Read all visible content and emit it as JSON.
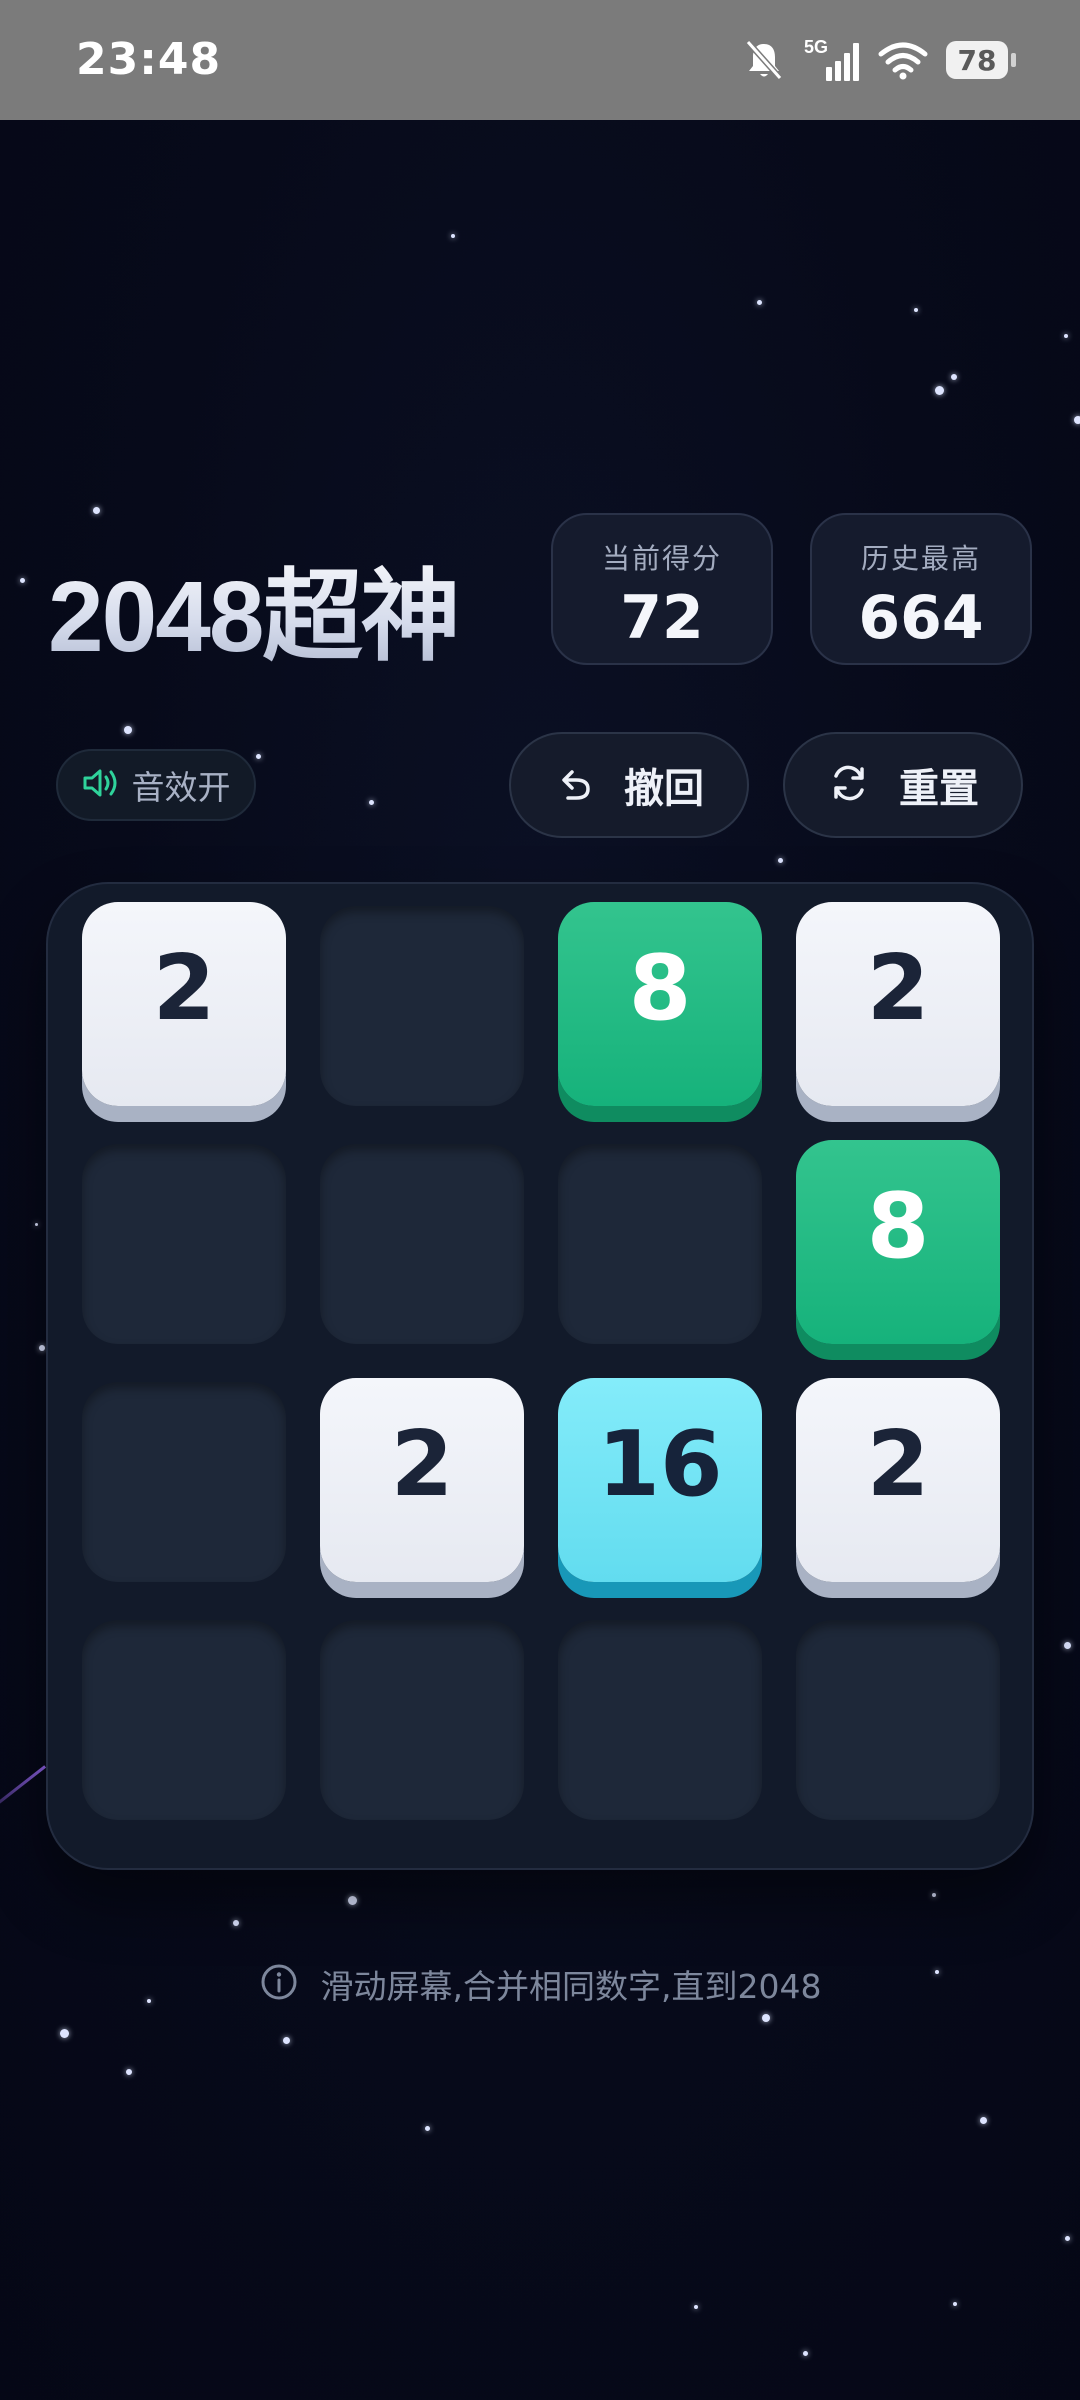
{
  "status_bar": {
    "time": "23:48",
    "network": "5G",
    "battery": "78",
    "icons": [
      "bell-muted-icon",
      "signal-icon",
      "wifi-icon",
      "battery-icon"
    ]
  },
  "header": {
    "title": "2048超神",
    "current_score_label": "当前得分",
    "current_score": "72",
    "best_score_label": "历史最高",
    "best_score": "664"
  },
  "controls": {
    "sound_label": "音效开",
    "undo_label": "撤回",
    "reset_label": "重置"
  },
  "board": {
    "rows": [
      [
        2,
        null,
        8,
        2
      ],
      [
        null,
        null,
        null,
        8
      ],
      [
        null,
        2,
        16,
        2
      ],
      [
        null,
        null,
        null,
        null
      ]
    ]
  },
  "hint": {
    "text": "滑动屏幕,合并相同数字,直到2048"
  },
  "colors": {
    "accent_green": "#16b27b",
    "accent_cyan": "#62dcef",
    "background": "#070a1a"
  }
}
